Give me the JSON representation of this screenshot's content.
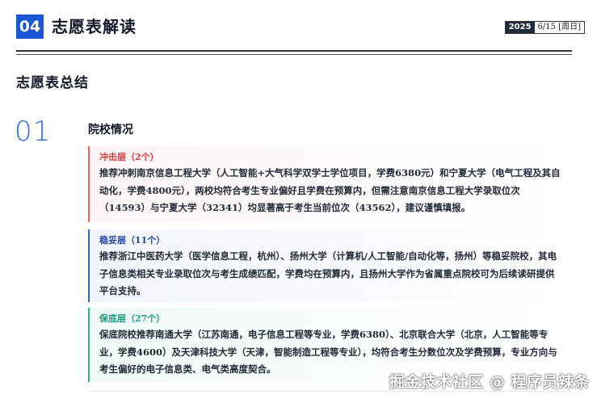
{
  "header": {
    "badge": "04",
    "title": "志愿表解读",
    "date_year": "2025",
    "date_rest": "6/15 [周日]"
  },
  "section": {
    "title": "志愿表总结",
    "number": "01",
    "subtitle": "院校情况"
  },
  "cards": [
    {
      "title": "冲击层（2个）",
      "body": "推荐冲刺南京信息工程大学（人工智能+大气科学双学士学位项目，学费6380元）和宁夏大学（电气工程及其自动化，学费4800元），两校均符合考生专业偏好且学费在预算内，但需注意南京信息工程大学录取位次（14593）与宁夏大学（32341）均显著高于考生当前位次（43562），建议谨慎填报。"
    },
    {
      "title": "稳妥层（11个）",
      "body": "推荐浙江中医药大学（医学信息工程，杭州）、扬州大学（计算机/人工智能/自动化等，扬州）等稳妥院校，其电子信息类相关专业录取位次与考生成绩匹配，学费均在预算内，且扬州大学作为省属重点院校可为后续读研提供平台支持。"
    },
    {
      "title": "保底层（27个）",
      "body": "保底院校推荐南通大学（江苏南通，电子信息工程等专业，学费6380）、北京联合大学（北京，人工智能等专业，学费4600）及天津科技大学（天津，智能制造工程等专业），均符合考生分数位次及学费预算，专业方向与考生偏好的电子信息类、电气类高度契合。"
    }
  ],
  "watermark": "掘金技术社区 @ 程序员辣条",
  "colors": {
    "accent": "#1a56d6",
    "rush": "#d93b3b",
    "steady": "#2447a8",
    "safe": "#17a07f"
  }
}
